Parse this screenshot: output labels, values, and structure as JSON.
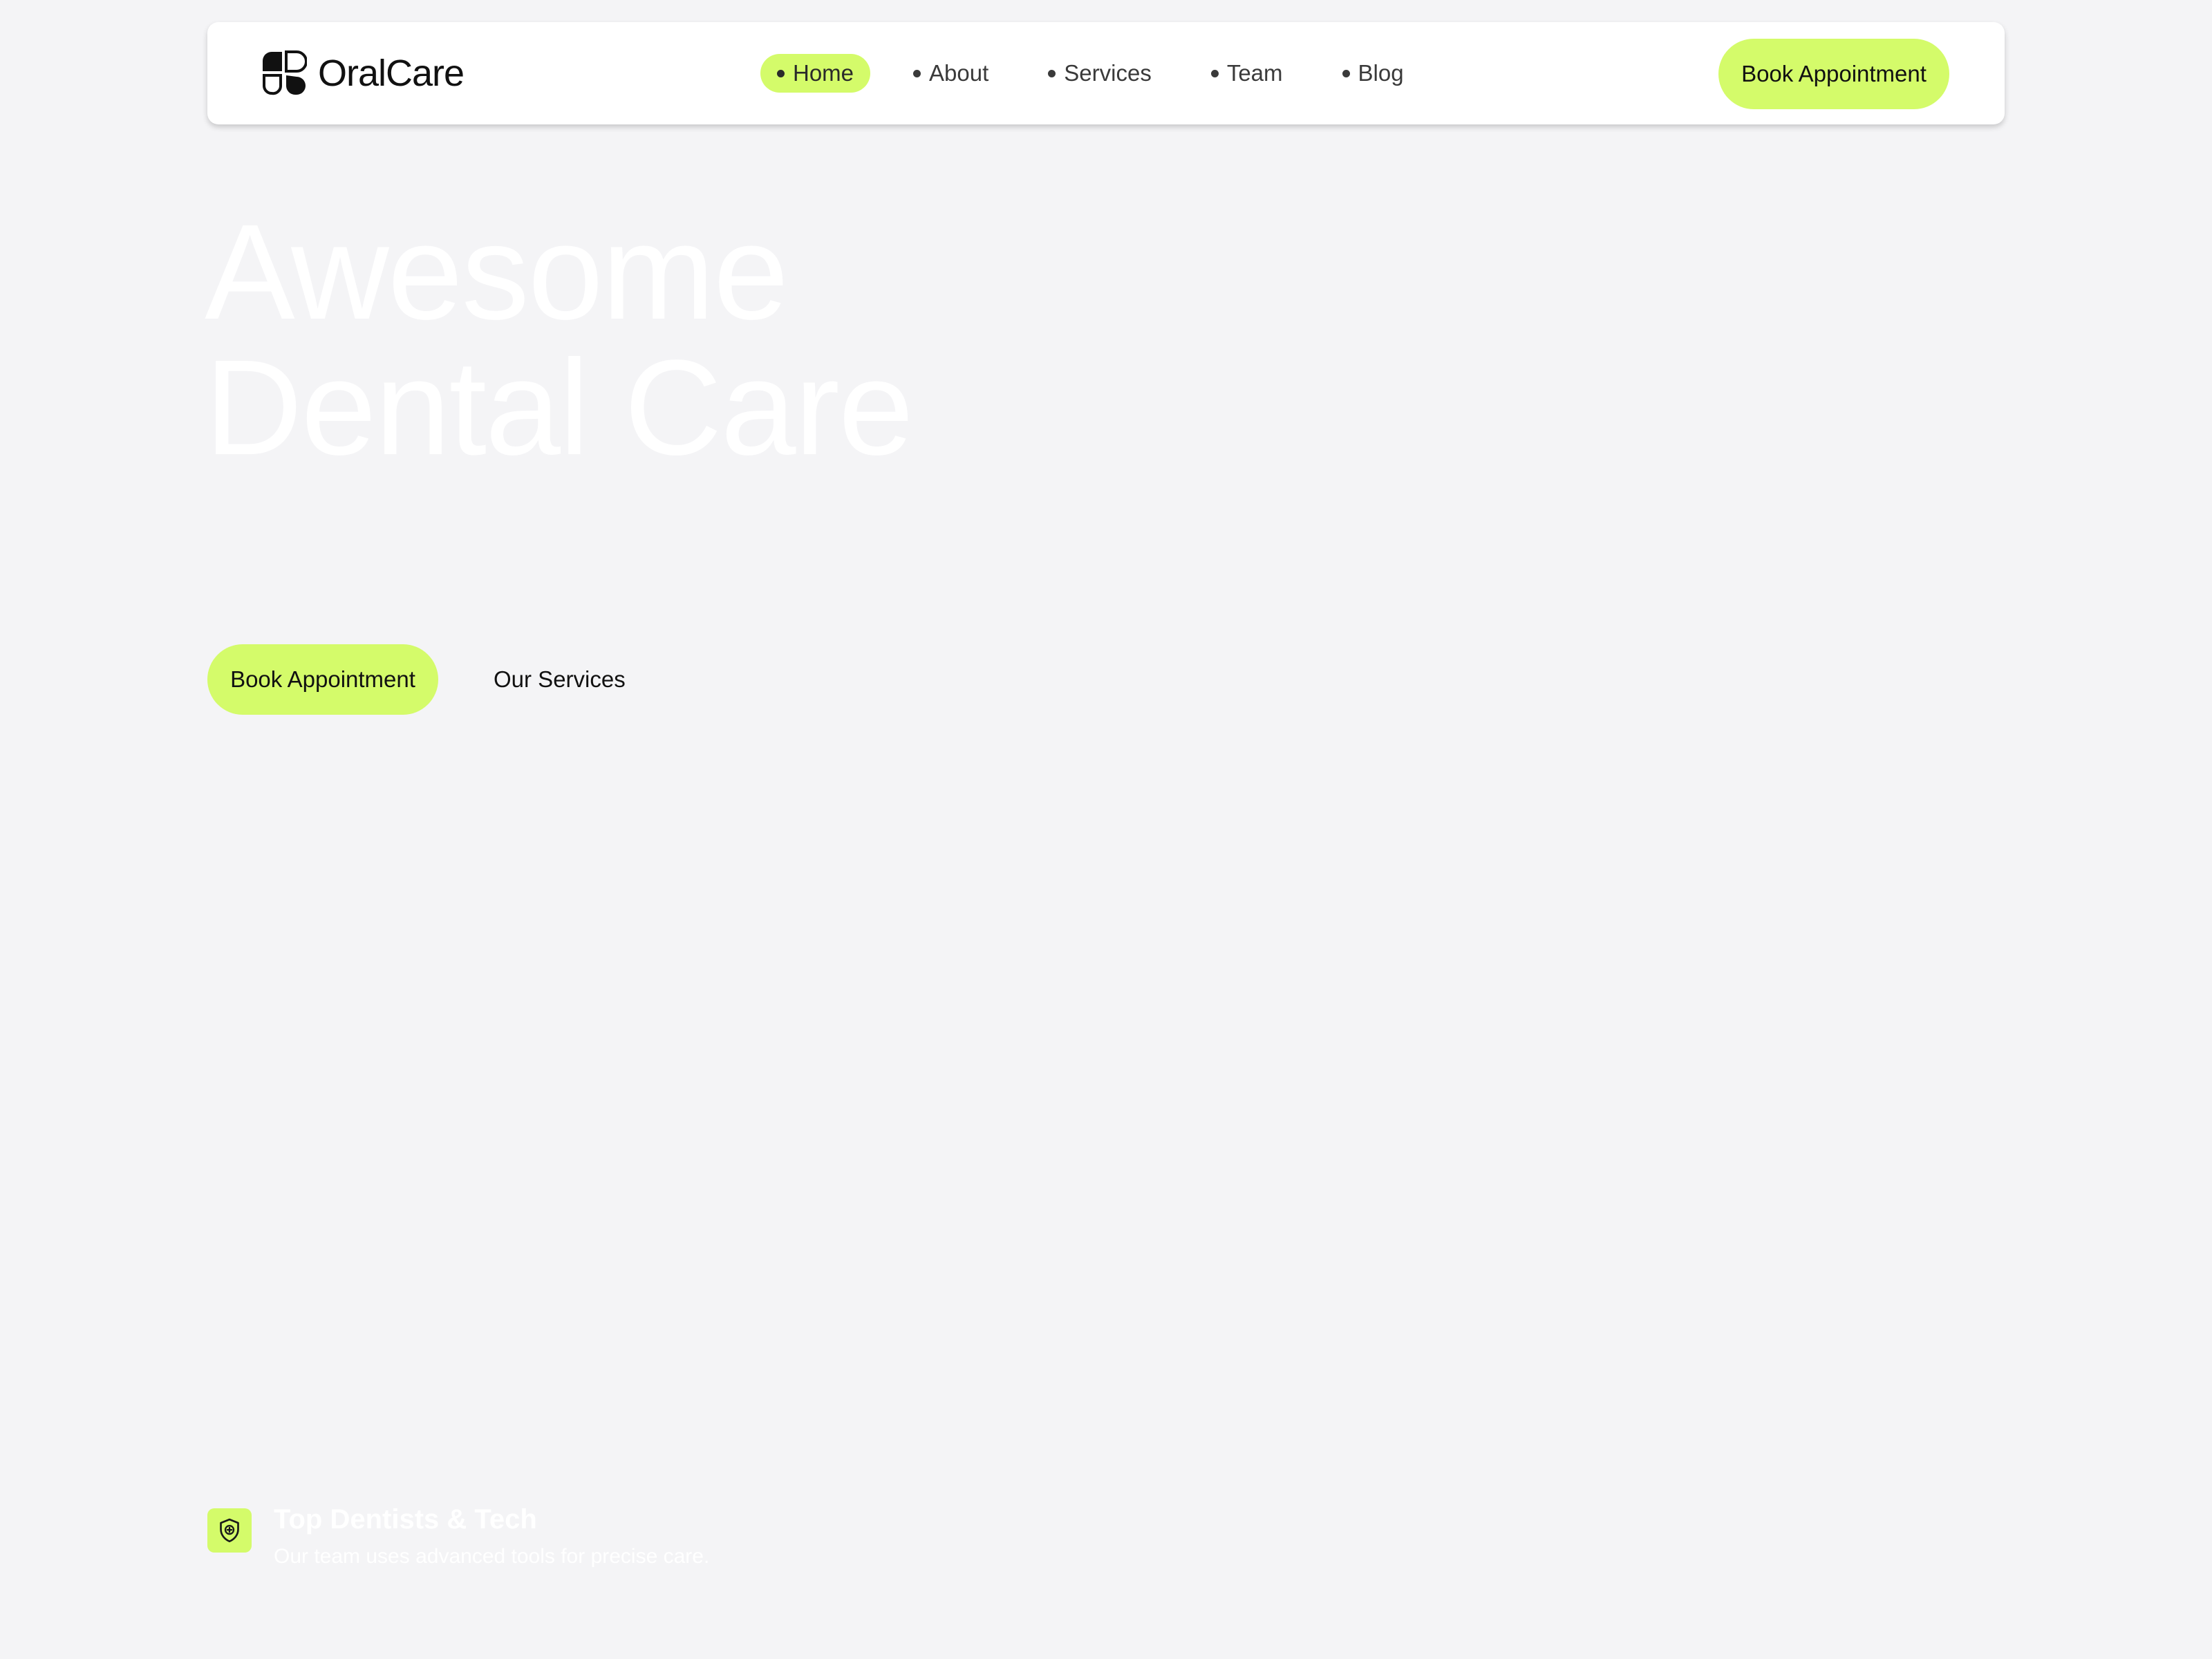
{
  "brand": {
    "name": "OralCare",
    "logo_icon": "brand-logo-icon"
  },
  "nav": {
    "items": [
      {
        "label": "Home",
        "active": true
      },
      {
        "label": "About",
        "active": false
      },
      {
        "label": "Services",
        "active": false
      },
      {
        "label": "Team",
        "active": false
      },
      {
        "label": "Blog",
        "active": false
      }
    ],
    "cta_label": "Book Appointment"
  },
  "hero": {
    "title_line1": "Awesome",
    "title_line2": "Dental Care",
    "primary_cta": "Book Appointment",
    "secondary_cta": "Our Services"
  },
  "feature": {
    "icon": "shield-icon",
    "title": "Top Dentists & Tech",
    "description": "Our team uses advanced tools for precise care."
  },
  "colors": {
    "accent": "#d4fb6a",
    "background": "#f4f4f6",
    "text": "#111111",
    "hero_text": "#ffffff"
  }
}
